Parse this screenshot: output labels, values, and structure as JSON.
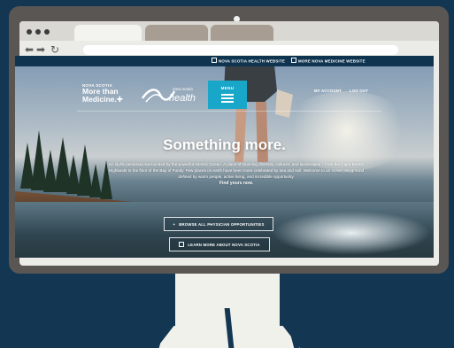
{
  "site": {
    "top_links": [
      "NOVA SCOTIA HEALTH WEBSITE",
      "MORE NOVA MEDICINE WEBSITE"
    ],
    "brand": {
      "small": "NOVA SCOTIA",
      "line1": "More than",
      "line2": "Medicine."
    },
    "partner_logo": {
      "line1": "nova scotia",
      "line2": "health"
    },
    "menu_label": "MENU",
    "account_links": [
      "MY ACCOUNT",
      "LOG OUT"
    ],
    "headline": "Something more.",
    "intro": "An idyllic peninsula surrounded by the powerful Atlantic Ocean. A place of stunning diversity, cultures, and landscapes – from the Cape Breton Highlands to the floor of the Bay of Fundy. Few places on earth have been more celebrated by sea and soil. Welcome to an ocean playground defined by warm people, active living, and incredible opportunity.",
    "intro_emphasis": "Find yours now.",
    "cta_primary": "BROWSE ALL PHYSICIAN OPPORTUNITIES",
    "cta_secondary": "LEARN MORE ABOUT NOVA SCOTIA"
  },
  "colors": {
    "page_bg": "#133652",
    "monitor_frame": "#5a5654",
    "site_topbar": "#0e3450",
    "menu_button": "#19a7c9"
  },
  "icons": [
    "back-arrow-icon",
    "forward-arrow-icon",
    "reload-icon",
    "external-link-icon",
    "hamburger-menu-icon",
    "plus-icon"
  ]
}
